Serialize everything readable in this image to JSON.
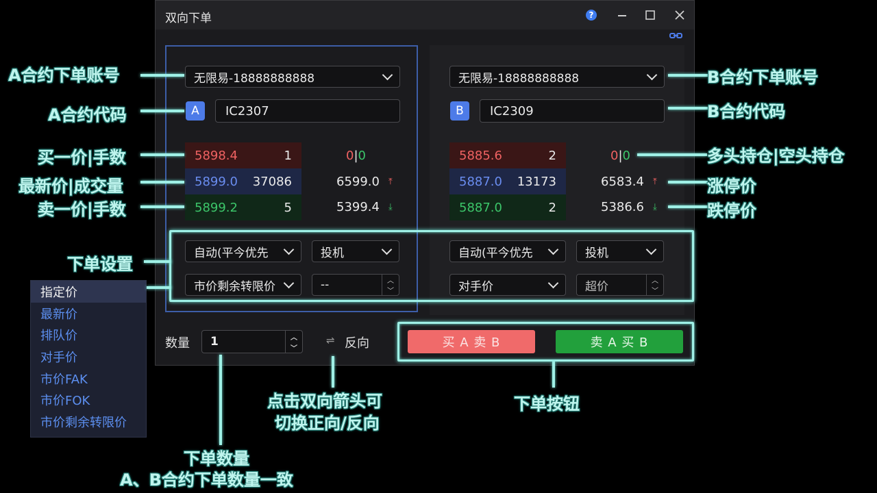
{
  "window": {
    "title": "双向下单",
    "help_icon": "?",
    "minimize_icon": "minimize-icon",
    "maximize_icon": "maximize-icon",
    "close_icon": "close-icon"
  },
  "contract_a": {
    "account": "无限易-18888888888",
    "badge": "A",
    "code": "IC2307",
    "sell1": {
      "price": "5898.4",
      "lots": "1"
    },
    "last": {
      "price": "5899.0",
      "volume": "37086"
    },
    "buy1": {
      "price": "5899.2",
      "lots": "5"
    },
    "position_long": "0",
    "position_sep": "|",
    "position_short": "0",
    "limit_up": "6599.0",
    "limit_down": "5399.4",
    "offset": "自动(平今优先",
    "hedge": "投机",
    "price_type": "市价剩余转限价",
    "price_value": "--"
  },
  "contract_b": {
    "account": "无限易-18888888888",
    "badge": "B",
    "code": "IC2309",
    "sell1": {
      "price": "5885.6",
      "lots": "2"
    },
    "last": {
      "price": "5887.0",
      "volume": "13173"
    },
    "buy1": {
      "price": "5887.0",
      "lots": "2"
    },
    "position_long": "0",
    "position_sep": "|",
    "position_short": "0",
    "limit_up": "6583.4",
    "limit_down": "5386.6",
    "offset": "自动(平今优先",
    "hedge": "投机",
    "price_type": "对手价",
    "price_value": "超价"
  },
  "bottom": {
    "qty_label": "数量",
    "qty_value": "1",
    "reverse_label": "反向",
    "buy_a_sell_b": "买 A 卖 B",
    "sell_a_buy_b": "卖 A 买 B"
  },
  "price_type_options": [
    "指定价",
    "最新价",
    "排队价",
    "对手价",
    "市价FAK",
    "市价FOK",
    "市价剩余转限价"
  ],
  "annotations": {
    "a_account": "A合约下单账号",
    "a_code": "A合约代码",
    "buy1": "买一价|手数",
    "last": "最新价|成交量",
    "sell1": "卖一价|手数",
    "order_settings": "下单设置",
    "b_account": "B合约下单账号",
    "b_code": "B合约代码",
    "position": "多头持仓|空头持仓",
    "limit_up": "涨停价",
    "limit_down": "跌停价",
    "reverse_line1": "点击双向箭头可",
    "reverse_line2": "切换正向/反向",
    "order_button": "下单按钮",
    "qty_line1": "下单数量",
    "qty_line2": "A、B合约下单数量一致"
  }
}
